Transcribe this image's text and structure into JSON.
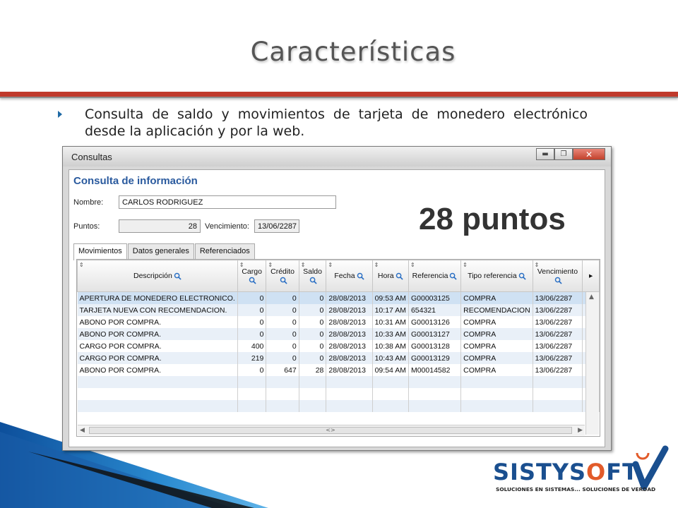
{
  "slide": {
    "title": "Características",
    "bullet": "Consulta de saldo y movimientos de tarjeta de monedero electrónico desde la aplicación y por la web."
  },
  "window": {
    "title": "Consultas",
    "panel_heading": "Consulta de información",
    "nombre_label": "Nombre:",
    "nombre_value": "CARLOS RODRIGUEZ",
    "puntos_label": "Puntos:",
    "puntos_value": "28",
    "vencimiento_label": "Vencimiento:",
    "vencimiento_value": "13/06/2287",
    "big_points": "28 puntos",
    "tabs": [
      "Movimientos",
      "Datos generales",
      "Referenciados"
    ],
    "columns": [
      "Descripción",
      "Cargo",
      "Crédito",
      "Saldo",
      "Fecha",
      "Hora",
      "Referencia",
      "Tipo referencia",
      "Vencimiento"
    ],
    "rows": [
      [
        "APERTURA DE MONEDERO ELECTRONICO.",
        "0",
        "0",
        "0",
        "28/08/2013",
        "09:53 AM",
        "G00003125",
        "COMPRA",
        "13/06/2287"
      ],
      [
        "TARJETA NUEVA CON RECOMENDACION.",
        "0",
        "0",
        "0",
        "28/08/2013",
        "10:17 AM",
        "654321",
        "RECOMENDACION",
        "13/06/2287"
      ],
      [
        "ABONO POR COMPRA.",
        "0",
        "0",
        "0",
        "28/08/2013",
        "10:31 AM",
        "G00013126",
        "COMPRA",
        "13/06/2287"
      ],
      [
        "ABONO POR COMPRA.",
        "0",
        "0",
        "0",
        "28/08/2013",
        "10:33 AM",
        "G00013127",
        "COMPRA",
        "13/06/2287"
      ],
      [
        "CARGO POR COMPRA.",
        "400",
        "0",
        "0",
        "28/08/2013",
        "10:38 AM",
        "G00013128",
        "COMPRA",
        "13/06/2287"
      ],
      [
        "CARGO POR COMPRA.",
        "219",
        "0",
        "0",
        "28/08/2013",
        "10:43 AM",
        "G00013129",
        "COMPRA",
        "13/06/2287"
      ],
      [
        "ABONO POR COMPRA.",
        "0",
        "647",
        "28",
        "28/08/2013",
        "09:54 AM",
        "M00014582",
        "COMPRA",
        "13/06/2287"
      ]
    ],
    "scroll_indicator": "<>"
  },
  "logo": {
    "name": "SISTYSOFT",
    "tagline": "SOLUCIONES EN SISTEMAS... SOLUCIONES DE VERDAD"
  },
  "colors": {
    "accent_red": "#c0392b",
    "heading_blue": "#2a5a9e",
    "corner_blue": "#1a5ea8"
  }
}
